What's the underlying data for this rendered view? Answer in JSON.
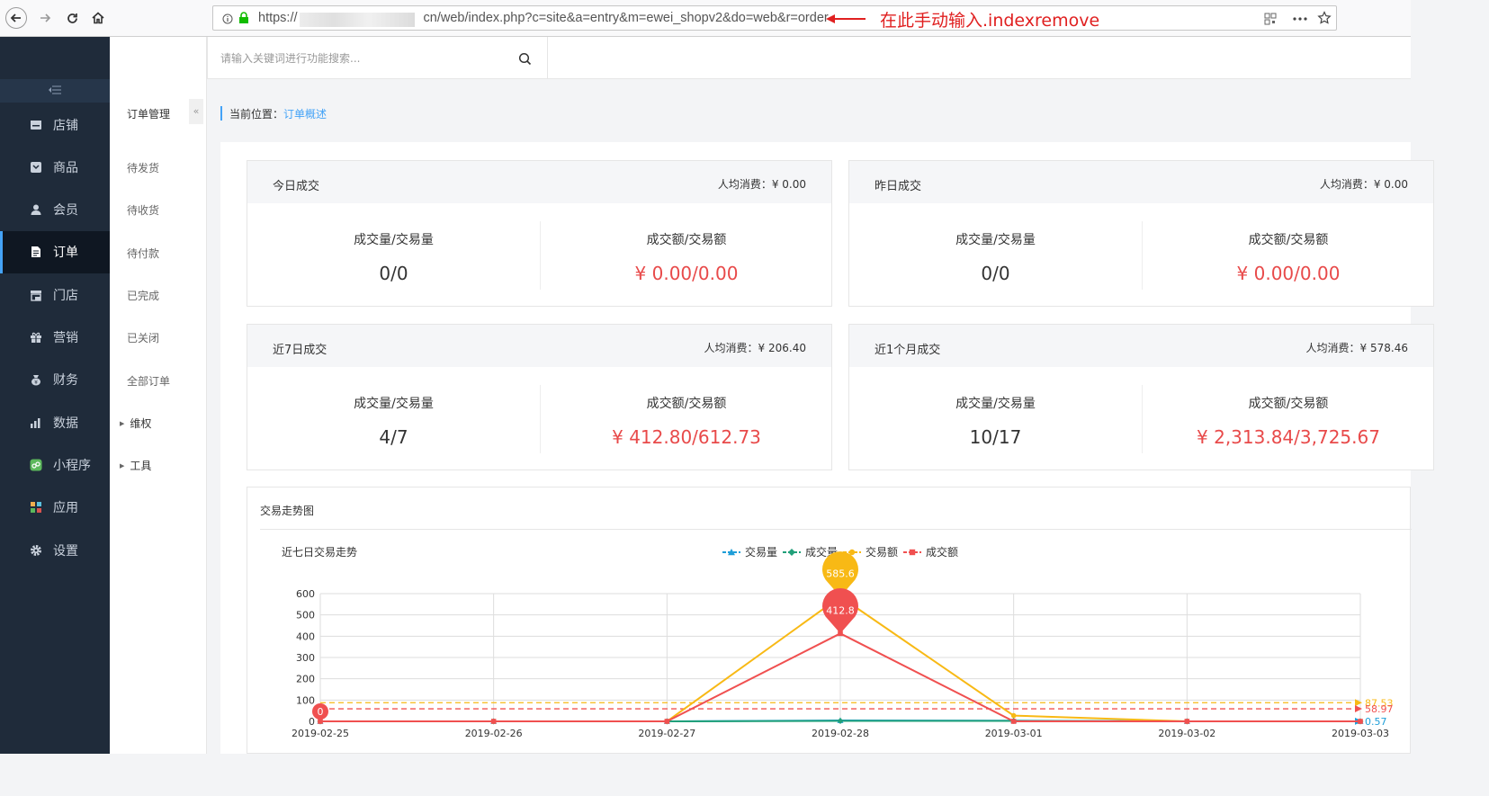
{
  "browser": {
    "url_prefix": "https://",
    "url_suffix": "cn/web/index.php?c=site&a=entry&m=ewei_shopv2&do=web&r=order",
    "annotation": "在此手动输入.indexremove"
  },
  "sidebar": {
    "items": [
      {
        "label": "店铺",
        "icon": "store-icon"
      },
      {
        "label": "商品",
        "icon": "goods-icon"
      },
      {
        "label": "会员",
        "icon": "member-icon"
      },
      {
        "label": "订单",
        "icon": "order-icon",
        "active": true
      },
      {
        "label": "门店",
        "icon": "shop-icon"
      },
      {
        "label": "营销",
        "icon": "gift-icon"
      },
      {
        "label": "财务",
        "icon": "finance-icon"
      },
      {
        "label": "数据",
        "icon": "chart-icon"
      },
      {
        "label": "小程序",
        "icon": "miniapp-icon"
      },
      {
        "label": "应用",
        "icon": "apps-icon"
      },
      {
        "label": "设置",
        "icon": "gear-icon"
      }
    ]
  },
  "topnav": {
    "search_placeholder": "请输入关键词进行功能搜索..."
  },
  "subnav": {
    "title": "订单管理",
    "collapse": "«",
    "items": [
      "待发货",
      "待收货",
      "待付款",
      "已完成",
      "已关闭",
      "全部订单"
    ],
    "groups": [
      "维权",
      "工具"
    ]
  },
  "breadcrumb": {
    "prefix": "当前位置：",
    "current": "订单概述"
  },
  "cards": [
    {
      "title": "今日成交",
      "avg": "人均消费：¥ 0.00",
      "count_label": "成交量/交易量",
      "count": "0/0",
      "amount_label": "成交额/交易额",
      "amount": "¥ 0.00/0.00"
    },
    {
      "title": "昨日成交",
      "avg": "人均消费：¥ 0.00",
      "count_label": "成交量/交易量",
      "count": "0/0",
      "amount_label": "成交额/交易额",
      "amount": "¥ 0.00/0.00"
    },
    {
      "title": "近7日成交",
      "avg": "人均消费：¥ 206.40",
      "count_label": "成交量/交易量",
      "count": "4/7",
      "amount_label": "成交额/交易额",
      "amount": "¥ 412.80/612.73"
    },
    {
      "title": "近1个月成交",
      "avg": "人均消费：¥ 578.46",
      "count_label": "成交量/交易量",
      "count": "10/17",
      "amount_label": "成交额/交易额",
      "amount": "¥ 2,313.84/3,725.67"
    }
  ],
  "chart_panel": {
    "title": "交易走势图"
  },
  "chart_data": {
    "type": "line",
    "title": "近七日交易走势",
    "categories": [
      "2019-02-25",
      "2019-02-26",
      "2019-02-27",
      "2019-02-28",
      "2019-03-01",
      "2019-03-02",
      "2019-03-03"
    ],
    "ylim": [
      0,
      600
    ],
    "yticks": [
      0,
      100,
      200,
      300,
      400,
      500,
      600
    ],
    "grid": true,
    "legend_position": "top-center",
    "series": [
      {
        "name": "交易量",
        "color": "#1e9ed8",
        "marker": "triangle",
        "values": [
          0,
          0,
          0,
          4,
          3,
          0,
          0
        ],
        "avg_line": 0.57,
        "avg_label": "0.57"
      },
      {
        "name": "成交量",
        "color": "#21a07a",
        "marker": "diamond",
        "values": [
          0,
          0,
          0,
          2,
          2,
          0,
          0
        ],
        "avg_line": null,
        "avg_label": null
      },
      {
        "name": "交易额",
        "color": "#f8b915",
        "marker": "circle",
        "values": [
          0,
          0,
          0,
          585.6,
          27.1,
          0,
          0
        ],
        "avg_line": 87.53,
        "avg_label": "87.53"
      },
      {
        "name": "成交额",
        "color": "#f05050",
        "marker": "square",
        "values": [
          0,
          0,
          0,
          412.8,
          0,
          0,
          0
        ],
        "avg_line": 58.97,
        "avg_label": "58.97"
      }
    ],
    "max_pins": [
      {
        "series": "交易额",
        "label": "585.6",
        "color": "#f8b915"
      },
      {
        "series": "成交额",
        "label": "412.8",
        "color": "#f05050"
      }
    ],
    "min_pins": [
      {
        "series": "成交额",
        "label": "0",
        "color": "#f05050"
      }
    ]
  }
}
